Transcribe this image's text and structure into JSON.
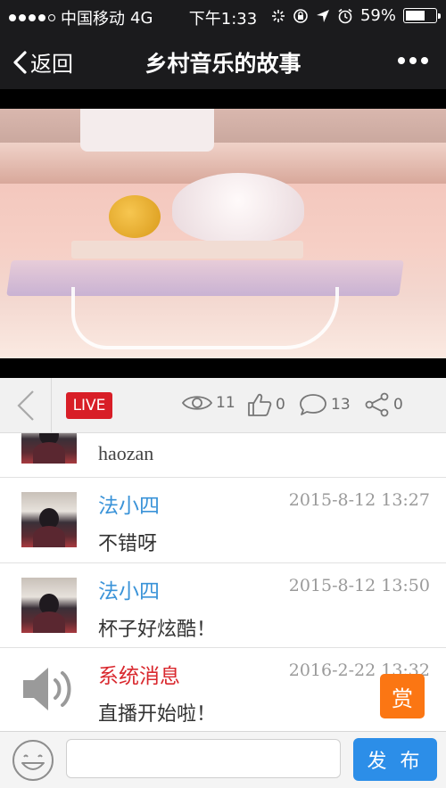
{
  "status_bar": {
    "carrier": "中国移动",
    "network": "4G",
    "time": "下午1:33",
    "battery": "59%"
  },
  "nav": {
    "back_label": "返回",
    "title": "乡村音乐的故事"
  },
  "stats": {
    "live_label": "LIVE",
    "views": "11",
    "likes": "0",
    "comments": "13",
    "shares": "0"
  },
  "comments": [
    {
      "name": "",
      "time": "",
      "text": "haozan"
    },
    {
      "name": "法小四",
      "time": "2015-8-12 13:27",
      "text": "不错呀"
    },
    {
      "name": "法小四",
      "time": "2015-8-12 13:50",
      "text": "杯子好炫酷！"
    },
    {
      "name": "系统消息",
      "time": "2016-2-22 13:32",
      "text": "直播开始啦！"
    }
  ],
  "reward_label": "赏",
  "input": {
    "value": "",
    "publish_label": "发 布"
  },
  "colors": {
    "bar": "#1b1b1d",
    "live": "#d81e27",
    "name_blue": "#3a93d8",
    "system_red": "#d9282e",
    "reward": "#fb7613",
    "publish": "#2c8ee8"
  }
}
